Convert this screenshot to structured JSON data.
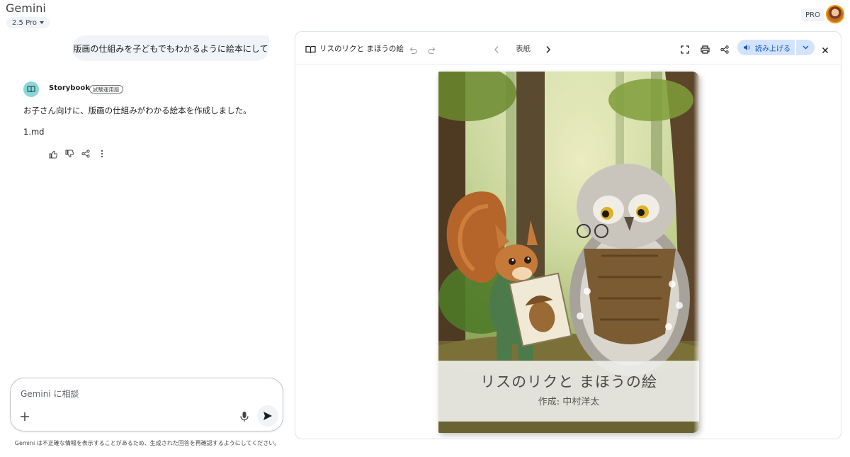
{
  "app": {
    "title": "Gemini",
    "model": "2.5 Pro",
    "plan_badge": "PRO"
  },
  "chat": {
    "user_message": "版画の仕組みを子どもでもわかるように絵本にして",
    "response": {
      "agent_name": "Storybook",
      "agent_badge": "試験運用版",
      "text": "お子さん向けに、版画の仕組みがわかる絵本を作成しました。",
      "file": "1.md"
    }
  },
  "input": {
    "placeholder": "Gemini に相談"
  },
  "disclaimer": "Gemini は不正確な情報を表示することがあるため、生成された回答を再確認するようにしてください。",
  "preview": {
    "title": "リスのリクと まほうの絵",
    "page_label": "表紙",
    "read_aloud_label": "読み上げる",
    "book": {
      "title": "リスのリクと まほうの絵",
      "author": "作成: 中村洋太"
    }
  },
  "colors": {
    "accent": "#0b57d0",
    "accent_bg": "#d3e3fd",
    "chip_bg": "#f0f4f9",
    "storybook_icon": "#8bd6d7"
  }
}
